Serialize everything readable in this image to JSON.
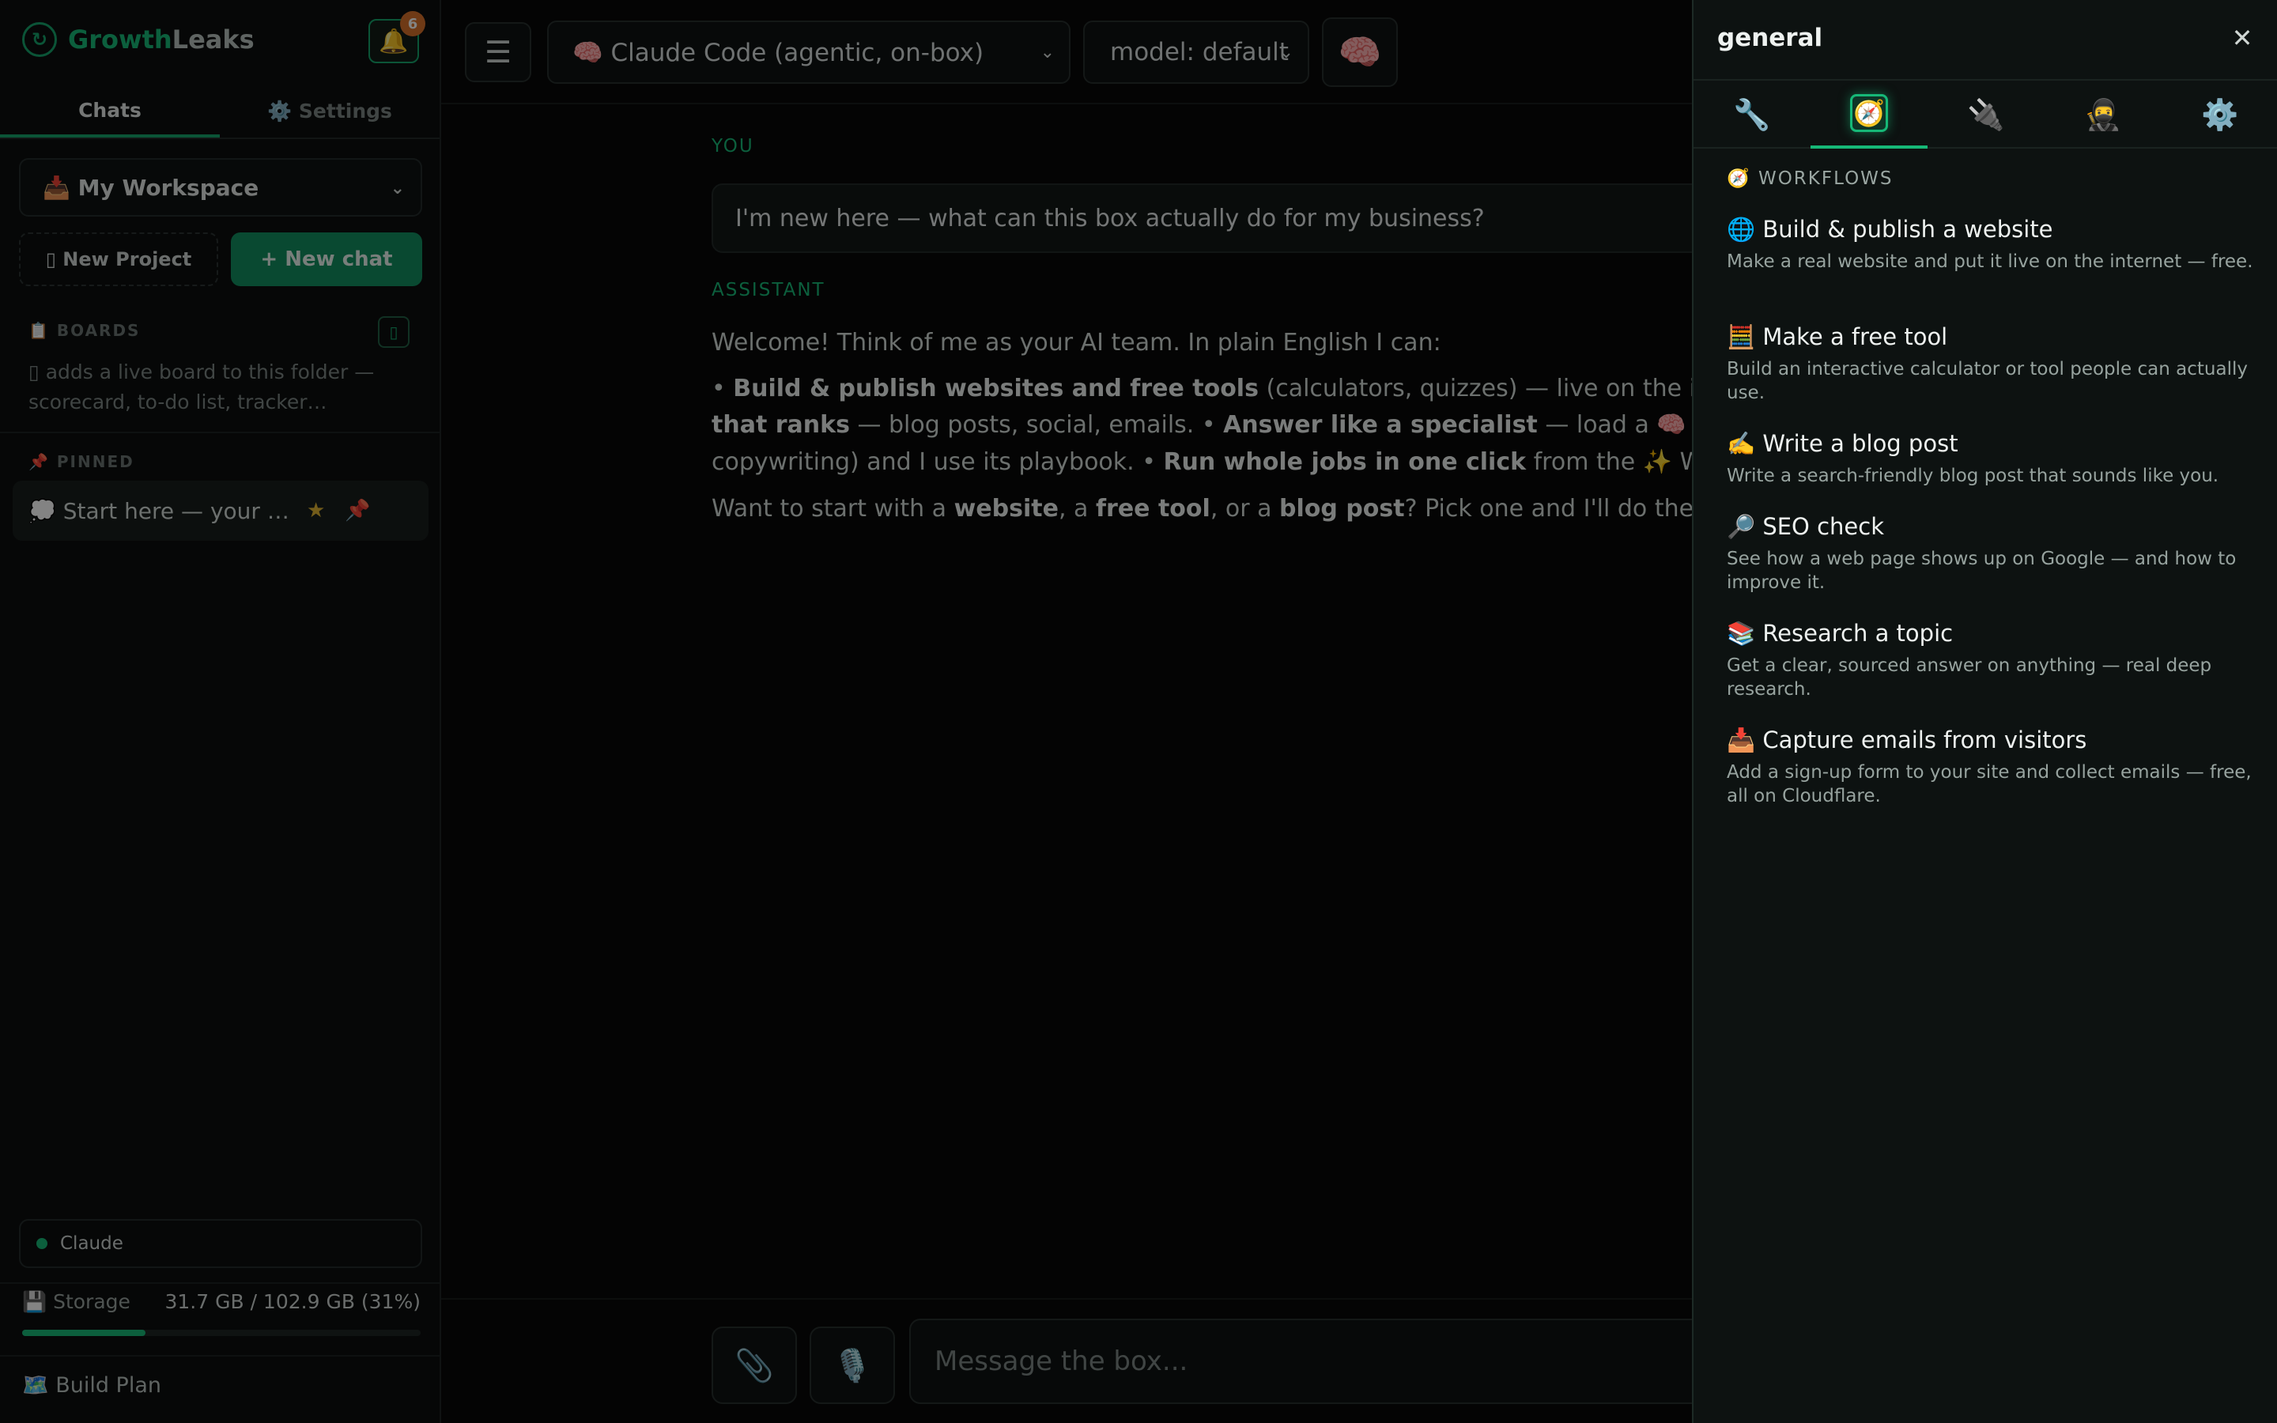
{
  "app": {
    "brand_part1": "Growth",
    "brand_part2": "Leaks",
    "notifications": "6"
  },
  "sidebar": {
    "tabs": [
      "Chats",
      "⚙️ Settings"
    ],
    "workspace": "📥 My Workspace",
    "new_project": "▯ New Project",
    "new_chat": "+ New chat",
    "boards_label": "📋 BOARDS",
    "boards_add": "▯",
    "boards_hint": "▯ adds a live board to this folder — scorecard, to-do list, tracker…",
    "pinned_label": "📌 PINNED",
    "pinned_item": "💭 Start here — your …",
    "star": "★",
    "pin": "📌",
    "claude_status": "Claude",
    "storage_label": "💾 Storage",
    "storage_value": "31.7 GB / 102.9 GB (31%)",
    "storage_fraction": 0.31,
    "build_plan": "🗺️ Build Plan"
  },
  "topbar": {
    "menu_icon": "☰",
    "agent": "🧠 Claude Code (agentic, on-box)",
    "model": "model: default",
    "brain": "🧠"
  },
  "chat": {
    "you_label": "YOU",
    "user_message": "I'm new here — what can this box actually do for my business?",
    "assistant_label": "ASSISTANT",
    "line1": "Welcome! Think of me as your AI team. In plain English I can:",
    "l2a": "• ",
    "l2b": "Build & publish websites and free tools",
    "l2c": " (calculators, quizzes) — live on the i",
    "l3a": "that ranks",
    "l3b": " — blog posts, social, emails. • ",
    "l3c": "Answer like a specialist",
    "l3d": " — load a 🧠",
    "l4a": "copywriting) and I use its playbook. • ",
    "l4b": "Run whole jobs in one click",
    "l4c": " from the ✨ W",
    "l5a": "Want to start with a ",
    "l5b": "website",
    "l5c": ", a ",
    "l5d": "free tool",
    "l5e": ", or a ",
    "l5f": "blog post",
    "l5g": "? Pick one and I'll do the"
  },
  "composer": {
    "attach": "📎",
    "mic": "🎙️",
    "placeholder": "Message the box..."
  },
  "drawer": {
    "title": "general",
    "close": "✕",
    "tabs": [
      "🔧",
      "🧭",
      "🔌",
      "🥷",
      "⚙️"
    ],
    "section": "🧭 WORKFLOWS",
    "items": [
      {
        "title": "🌐 Build & publish a website",
        "desc": "Make a real website and put it live on the internet — free."
      },
      {
        "title": "🧮 Make a free tool",
        "desc": "Build an interactive calculator or tool people can actually use."
      },
      {
        "title": "✍️ Write a blog post",
        "desc": "Write a search-friendly blog post that sounds like you."
      },
      {
        "title": "🔎 SEO check",
        "desc": "See how a web page shows up on Google — and how to improve it."
      },
      {
        "title": "📚 Research a topic",
        "desc": "Get a clear, sourced answer on anything — real deep research."
      },
      {
        "title": "📥 Capture emails from visitors",
        "desc": "Add a sign-up form to your site and collect emails — free, all on Cloudflare."
      }
    ]
  },
  "colors": {
    "accent": "#16b877",
    "button_green": "#0f8f5f",
    "badge": "#d9702a"
  }
}
